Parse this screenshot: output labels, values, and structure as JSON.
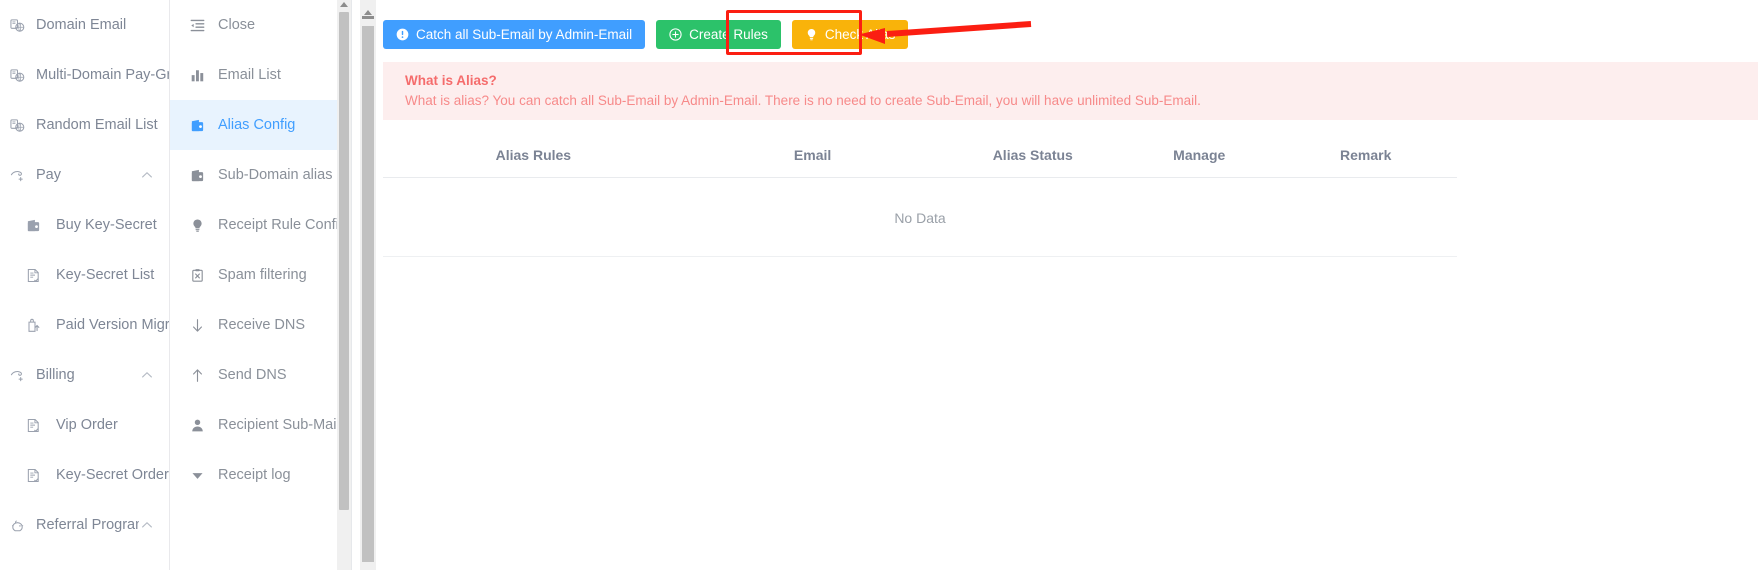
{
  "primary_sidebar": {
    "items": [
      {
        "label": "Domain Email",
        "icon": "domain-email-icon",
        "level": 1,
        "expandable": false
      },
      {
        "label": "Multi-Domain Pay-Group",
        "icon": "domain-email-icon",
        "level": 1,
        "expandable": false
      },
      {
        "label": "Random Email List",
        "icon": "domain-email-icon",
        "level": 1,
        "expandable": false
      },
      {
        "label": "Pay",
        "icon": "pay-icon",
        "level": 1,
        "expandable": true,
        "arrow": "chevron-up-icon"
      },
      {
        "label": "Buy Key-Secret",
        "icon": "wallet-icon",
        "level": 2,
        "expandable": false
      },
      {
        "label": "Key-Secret List",
        "icon": "list-doc-icon",
        "level": 2,
        "expandable": false
      },
      {
        "label": "Paid Version Migration",
        "icon": "migration-icon",
        "level": 2,
        "expandable": false
      },
      {
        "label": "Billing",
        "icon": "pay-icon",
        "level": 1,
        "expandable": true,
        "arrow": "chevron-up-icon"
      },
      {
        "label": "Vip Order",
        "icon": "list-doc-icon",
        "level": 2,
        "expandable": false
      },
      {
        "label": "Key-Secret Order",
        "icon": "list-doc-icon",
        "level": 2,
        "expandable": false
      },
      {
        "label": "Referral Program",
        "icon": "referral-icon",
        "level": 1,
        "expandable": true,
        "arrow": "chevron-up-icon"
      }
    ]
  },
  "secondary_menu": {
    "items": [
      {
        "label": "Close",
        "icon": "collapse-menu-icon",
        "active": false
      },
      {
        "label": "Email List",
        "icon": "bar-chart-icon",
        "active": false
      },
      {
        "label": "Alias Config",
        "icon": "wallet-icon",
        "active": true
      },
      {
        "label": "Sub-Domain alias",
        "icon": "wallet-icon",
        "active": false
      },
      {
        "label": "Receipt Rule Config",
        "icon": "bulb-icon",
        "active": false
      },
      {
        "label": "Spam filtering",
        "icon": "clipboard-x-icon",
        "active": false
      },
      {
        "label": "Receive DNS",
        "icon": "arrow-down-icon",
        "active": false
      },
      {
        "label": "Send DNS",
        "icon": "arrow-up-icon",
        "active": false
      },
      {
        "label": "Recipient Sub-Mail",
        "icon": "user-icon",
        "active": false
      },
      {
        "label": "Receipt log",
        "icon": "caret-down-icon",
        "active": false
      }
    ]
  },
  "toolbar": {
    "catch_all_label": "Catch all Sub-Email by Admin-Email",
    "catch_all_icon": "info-circle-icon",
    "create_rules_label": "Create Rules",
    "create_rules_icon": "plus-circle-icon",
    "check_alias_label": "Check Alias",
    "check_alias_icon": "bulb-icon"
  },
  "alert": {
    "title": "What is Alias?",
    "description": "What is alias? You can catch all Sub-Email by Admin-Email. There is no need to create Sub-Email, you will have unlimited Sub-Email."
  },
  "table": {
    "columns": [
      "Alias Rules",
      "Email",
      "Alias Status",
      "Manage",
      "Remark"
    ],
    "empty_text": "No Data",
    "rows": []
  },
  "annotation": {
    "target": "check-alias-button",
    "color": "#fb1e12",
    "shape": "rectangle-with-left-arrow"
  },
  "colors": {
    "primary": "#409eff",
    "success": "#2cc26a",
    "warning": "#f9b30a",
    "alert_bg": "#fdeeee",
    "alert_text": "#f56c6c",
    "active_menu_bg": "#e8f3fe",
    "annotation": "#fb1e12"
  }
}
